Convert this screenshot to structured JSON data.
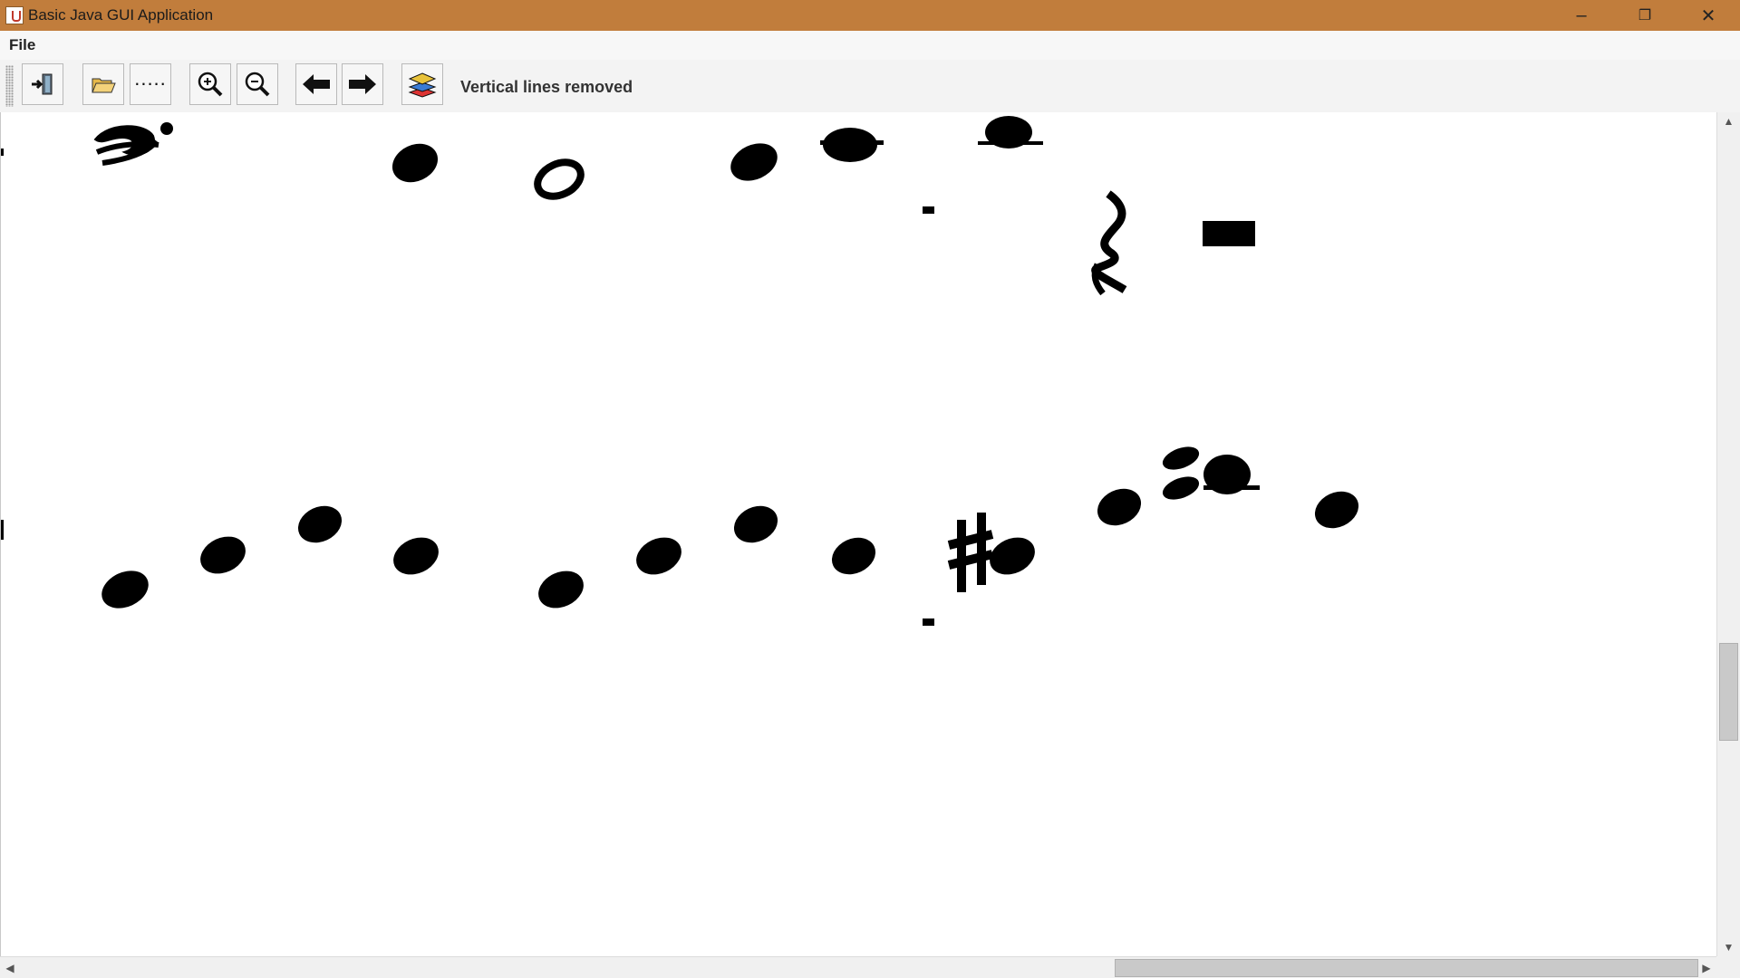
{
  "window": {
    "title": "Basic Java GUI Application",
    "controls": {
      "minimize": "–",
      "restore": "❐",
      "close": "✕"
    }
  },
  "menu": {
    "file": "File"
  },
  "toolbar": {
    "buttons": [
      {
        "name": "exit-button",
        "icon": "exit-door-icon"
      },
      {
        "name": "open-button",
        "icon": "open-folder-icon"
      },
      {
        "name": "dots-button",
        "label": "....."
      },
      {
        "name": "zoom-in-button",
        "icon": "zoom-in-icon"
      },
      {
        "name": "zoom-out-button",
        "icon": "zoom-out-icon"
      },
      {
        "name": "back-button",
        "icon": "arrow-left-icon"
      },
      {
        "name": "forward-button",
        "icon": "arrow-right-icon"
      },
      {
        "name": "layers-button",
        "icon": "layers-icon"
      }
    ],
    "status": "Vertical lines removed"
  },
  "scrollbars": {
    "vertical_position": 0.63,
    "horizontal_position": 0.66
  }
}
